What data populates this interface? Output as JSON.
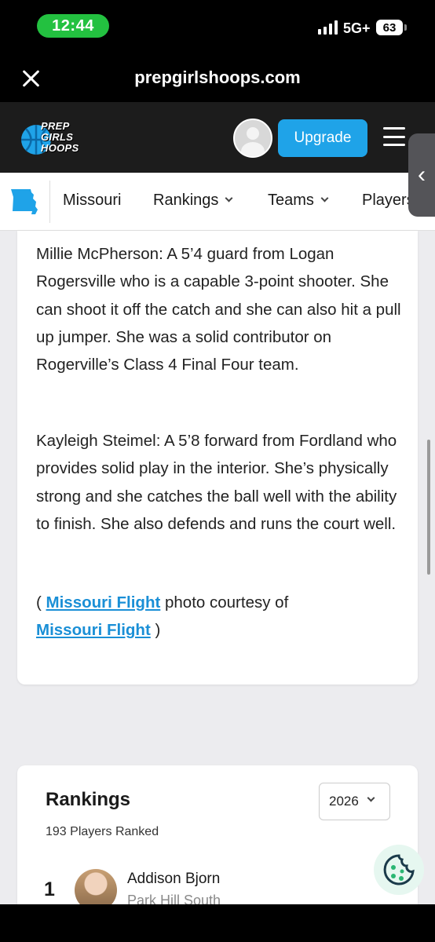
{
  "status_bar": {
    "time": "12:44",
    "network": "5G+",
    "battery": "63"
  },
  "browser": {
    "url": "prepgirlshoops.com"
  },
  "header": {
    "logo_lines": [
      "PREP",
      "GIRLS",
      "HOOPS"
    ],
    "upgrade_label": "Upgrade"
  },
  "subnav": {
    "state": "Missouri",
    "items": [
      {
        "label": "Rankings"
      },
      {
        "label": "Teams"
      },
      {
        "label": "Players"
      }
    ]
  },
  "article": {
    "paragraph1": "Millie McPherson: A 5’4 guard from Logan Rogersville who is a capable 3-point shooter. She can shoot it off the catch and she can also hit a pull up jumper. She was a solid contributor on Rogerville’s Class 4 Final Four team.",
    "paragraph2": "Kayleigh Steimel: A 5’8 forward from Fordland who provides solid play in the interior. She’s physically strong and she catches the ball well with the ability to finish. She also defends and runs the court well.",
    "credit_open": "( ",
    "credit_link1": "Missouri Flight",
    "credit_middle": " photo courtesy of",
    "credit_link2": "Missouri Flight",
    "credit_close": " )"
  },
  "rankings": {
    "title": "Rankings",
    "year": "2026",
    "count_text": "193 Players Ranked",
    "players": [
      {
        "rank": "1",
        "name": "Addison Bjorn",
        "school": "Park Hill South"
      }
    ]
  },
  "colors": {
    "accent": "#1fa3e8",
    "link": "#1a8fd6",
    "status_green": "#23c140"
  }
}
